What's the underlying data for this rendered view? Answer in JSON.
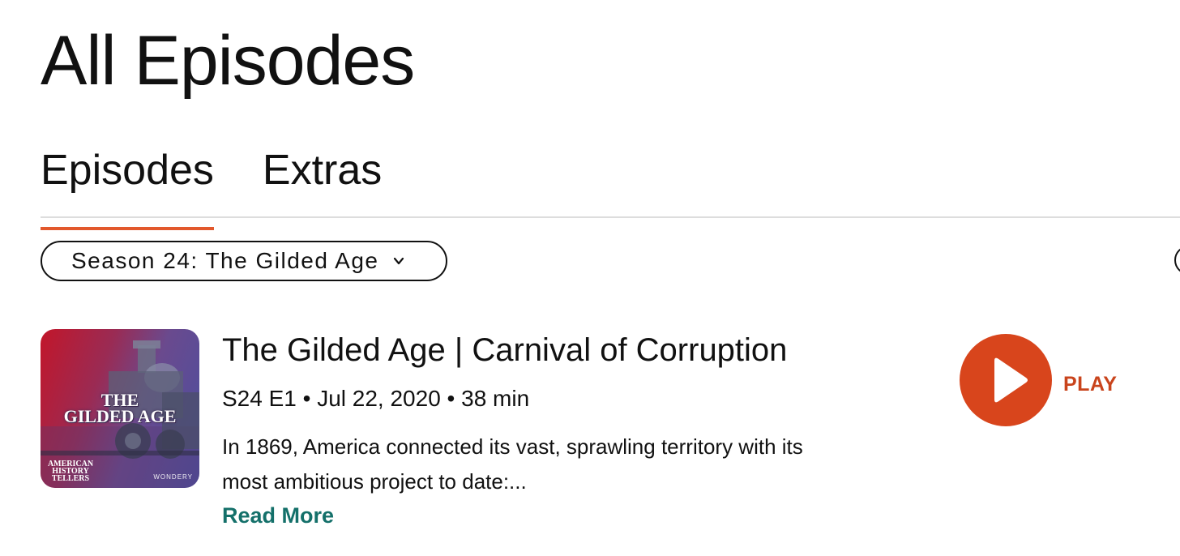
{
  "page": {
    "title": "All Episodes"
  },
  "tabs": [
    {
      "label": "Episodes",
      "active": true
    },
    {
      "label": "Extras",
      "active": false
    }
  ],
  "season_select": {
    "selected": "Season 24: The Gilded Age",
    "icon": "chevron-down-icon"
  },
  "episodes": [
    {
      "title": "The Gilded Age | Carnival of Corruption",
      "meta": "S24 E1 • Jul 22, 2020 • 38 min",
      "description": "In 1869, America connected its vast, sprawling territory with its most ambitious project to date:...",
      "read_more_label": "Read More",
      "play_label": "PLAY",
      "artwork": {
        "title_line1": "THE",
        "title_line2": "GILDED AGE",
        "brand_line1": "AMERICAN",
        "brand_line2": "HISTORY",
        "brand_line3": "TELLERS",
        "network": "WONDERY"
      }
    }
  ],
  "colors": {
    "accent": "#e2582c",
    "play": "#d8451c",
    "link": "#14706a"
  }
}
